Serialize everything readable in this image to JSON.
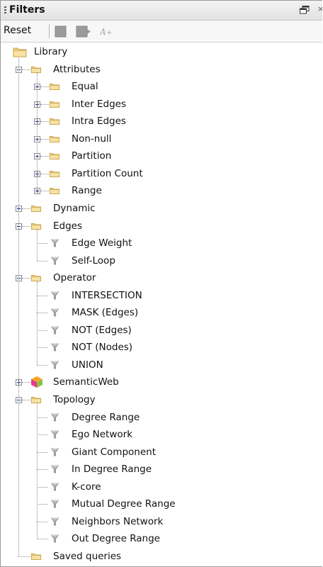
{
  "window": {
    "title": "Filters",
    "close_glyph": "×"
  },
  "toolbar": {
    "reset_label": "Reset",
    "icons": [
      "filter-stop-icon",
      "filter-export-icon",
      "auto-refresh-icon"
    ]
  },
  "tree": {
    "root": "Library",
    "attributes": {
      "label": "Attributes",
      "items": [
        "Equal",
        "Inter Edges",
        "Intra Edges",
        "Non-null",
        "Partition",
        "Partition Count",
        "Range"
      ]
    },
    "dynamic": {
      "label": "Dynamic"
    },
    "edges": {
      "label": "Edges",
      "items": [
        "Edge Weight",
        "Self-Loop"
      ]
    },
    "operator": {
      "label": "Operator",
      "items": [
        "INTERSECTION",
        "MASK (Edges)",
        "NOT (Edges)",
        "NOT (Nodes)",
        "UNION"
      ]
    },
    "semanticweb": {
      "label": "SemanticWeb"
    },
    "topology": {
      "label": "Topology",
      "items": [
        "Degree Range",
        "Ego Network",
        "Giant Component",
        "In Degree Range",
        "K-core",
        "Mutual Degree Range",
        "Neighbors Network",
        "Out Degree Range"
      ]
    },
    "saved": {
      "label": "Saved queries"
    }
  }
}
